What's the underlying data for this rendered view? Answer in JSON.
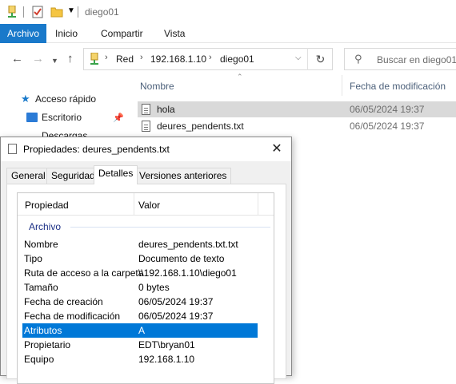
{
  "window": {
    "title": "diego01"
  },
  "ribbon": {
    "tabs": [
      "Archivo",
      "Inicio",
      "Compartir",
      "Vista"
    ]
  },
  "address": {
    "crumbs": [
      "Red",
      "192.168.1.10",
      "diego01"
    ]
  },
  "search": {
    "placeholder": "Buscar en diego01"
  },
  "nav": {
    "items": [
      "Acceso rápido",
      "Escritorio",
      "Descargas"
    ]
  },
  "files": {
    "columns": [
      "Nombre",
      "Fecha de modificación"
    ],
    "rows": [
      {
        "name": "hola",
        "date": "06/05/2024 19:37"
      },
      {
        "name": "deures_pendents.txt",
        "date": "06/05/2024 19:37"
      }
    ]
  },
  "dialog": {
    "title": "Propiedades: deures_pendents.txt",
    "tabs": [
      "General",
      "Seguridad",
      "Detalles",
      "Versiones anteriores"
    ],
    "columns": [
      "Propiedad",
      "Valor"
    ],
    "group": "Archivo",
    "rows": [
      {
        "name": "Nombre",
        "value": "deures_pendents.txt.txt"
      },
      {
        "name": "Tipo",
        "value": "Documento de texto"
      },
      {
        "name": "Ruta de acceso a la carpeta",
        "value": "\\\\192.168.1.10\\diego01"
      },
      {
        "name": "Tamaño",
        "value": "0 bytes"
      },
      {
        "name": "Fecha de creación",
        "value": "06/05/2024 19:37"
      },
      {
        "name": "Fecha de modificación",
        "value": "06/05/2024 19:37"
      },
      {
        "name": "Atributos",
        "value": "A"
      },
      {
        "name": "Propietario",
        "value": "EDT\\bryan01"
      },
      {
        "name": "Equipo",
        "value": "192.168.1.10"
      }
    ]
  },
  "colors": {
    "accent": "#1979ca",
    "selection": "#0078d7"
  }
}
